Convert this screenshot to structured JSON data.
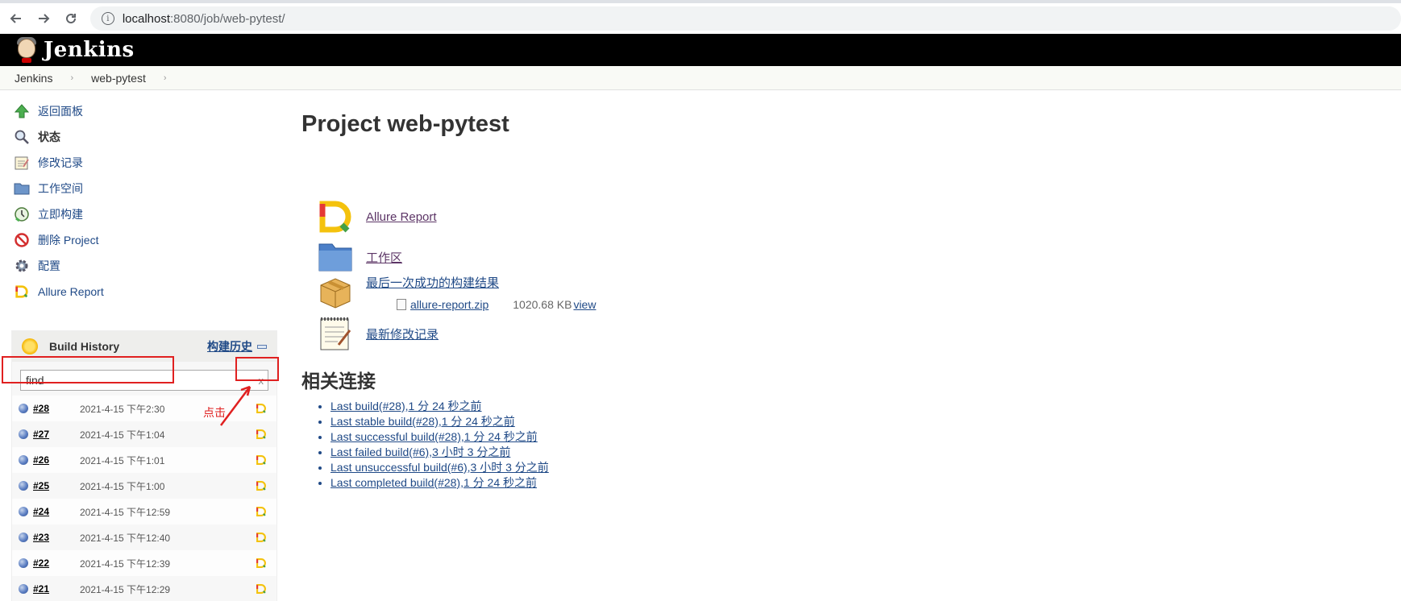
{
  "browser": {
    "url_host": "localhost",
    "url_path": ":8080/job/web-pytest/"
  },
  "header": {
    "title": "Jenkins"
  },
  "breadcrumbs": [
    {
      "label": "Jenkins"
    },
    {
      "label": "web-pytest"
    }
  ],
  "sidebar": {
    "items": [
      {
        "label": "返回面板",
        "icon": "up-arrow-icon"
      },
      {
        "label": "状态",
        "icon": "search-icon"
      },
      {
        "label": "修改记录",
        "icon": "notepad-icon"
      },
      {
        "label": "工作空间",
        "icon": "folder-icon"
      },
      {
        "label": "立即构建",
        "icon": "clock-icon"
      },
      {
        "label": "删除 Project",
        "icon": "no-entry-icon"
      },
      {
        "label": "配置",
        "icon": "gear-icon"
      },
      {
        "label": "Allure Report",
        "icon": "allure-icon"
      }
    ]
  },
  "build_history": {
    "title": "Build History",
    "trend_label": "构建历史",
    "search_value": "find",
    "clear_label": "x",
    "builds": [
      {
        "number": "#28",
        "date": "2021-4-15 下午2:30"
      },
      {
        "number": "#27",
        "date": "2021-4-15 下午1:04"
      },
      {
        "number": "#26",
        "date": "2021-4-15 下午1:01"
      },
      {
        "number": "#25",
        "date": "2021-4-15 下午1:00"
      },
      {
        "number": "#24",
        "date": "2021-4-15 下午12:59"
      },
      {
        "number": "#23",
        "date": "2021-4-15 下午12:40"
      },
      {
        "number": "#22",
        "date": "2021-4-15 下午12:39"
      },
      {
        "number": "#21",
        "date": "2021-4-15 下午12:29"
      }
    ]
  },
  "annotation": {
    "label": "点击"
  },
  "main": {
    "title": "Project web-pytest",
    "allure_link": "Allure Report",
    "workspace_link": "工作区",
    "last_success_link": "最后一次成功的构建结果",
    "artifact": {
      "name": "allure-report.zip",
      "size": "1020.68 KB",
      "view": "view"
    },
    "changes_link": "最新修改记录",
    "related_title": "相关连接",
    "permalinks": [
      "Last build(#28),1 分 24 秒之前",
      "Last stable build(#28),1 分 24 秒之前",
      "Last successful build(#28),1 分 24 秒之前",
      "Last failed build(#6),3 小时 3 分之前",
      "Last unsuccessful build(#6),3 小时 3 分之前",
      "Last completed build(#28),1 分 24 秒之前"
    ]
  },
  "colors": {
    "link": "#204a87",
    "visited_link": "#5c3566",
    "annotation_red": "#e02020",
    "header_bg": "#000000"
  }
}
